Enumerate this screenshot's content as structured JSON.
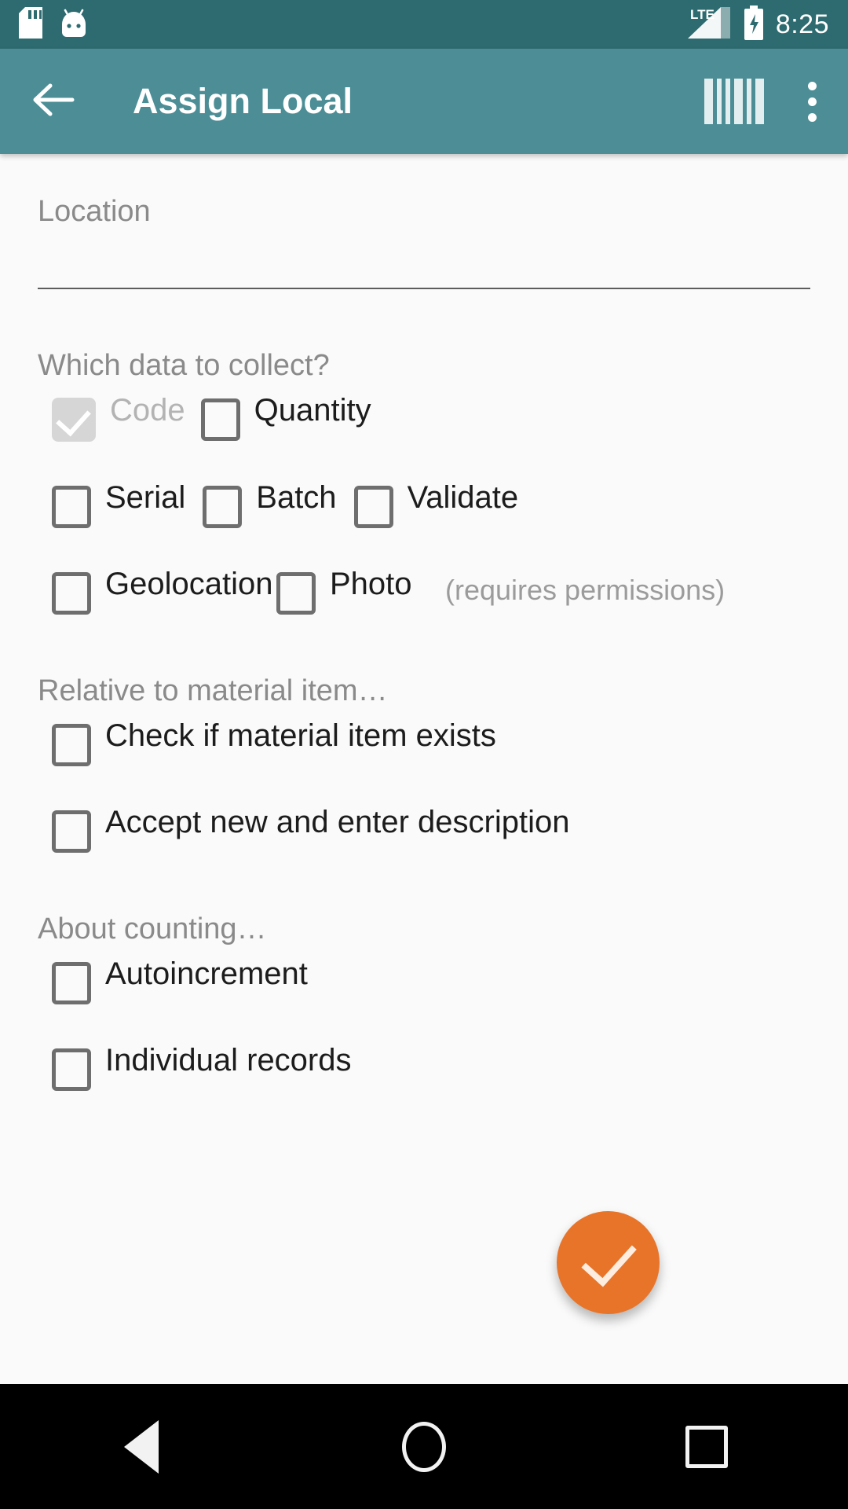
{
  "statusbar": {
    "time": "8:25",
    "icons": [
      "sd-card-icon",
      "android-head-icon",
      "lte-label",
      "signal-icon",
      "battery-charging-icon"
    ],
    "network_label": "LTE"
  },
  "appbar": {
    "back_label": "Back",
    "title": "Assign Local",
    "barcode_action": "Scan barcode",
    "overflow_action": "More options",
    "background": "#4D8E96"
  },
  "form": {
    "location": {
      "label": "Location",
      "value": "",
      "placeholder": ""
    },
    "collect_section": {
      "title": "Which data to collect?",
      "row1": [
        {
          "label": "Code",
          "checked": true,
          "disabled": true
        },
        {
          "label": "Quantity",
          "checked": false,
          "disabled": false
        }
      ],
      "row2": [
        {
          "label": "Serial",
          "checked": false,
          "disabled": false
        },
        {
          "label": "Batch",
          "checked": false,
          "disabled": false
        },
        {
          "label": "Validate",
          "checked": false,
          "disabled": false
        }
      ],
      "row3": [
        {
          "label": "Geolocation",
          "checked": false,
          "disabled": false
        },
        {
          "label": "Photo",
          "checked": false,
          "disabled": false
        }
      ],
      "permissions_note": "(requires permissions)"
    },
    "material_section": {
      "title": "Relative to material item…",
      "items": [
        {
          "label": "Check if material item exists",
          "checked": false
        },
        {
          "label": "Accept new and enter description",
          "checked": false
        }
      ]
    },
    "counting_section": {
      "title": "About counting…",
      "items": [
        {
          "label": "Autoincrement",
          "checked": false
        },
        {
          "label": "Individual records",
          "checked": false
        }
      ]
    }
  },
  "fab": {
    "action": "Confirm",
    "color": "#E8742A"
  },
  "navbar": {
    "back": "Back",
    "home": "Home",
    "recents": "Recent apps"
  }
}
